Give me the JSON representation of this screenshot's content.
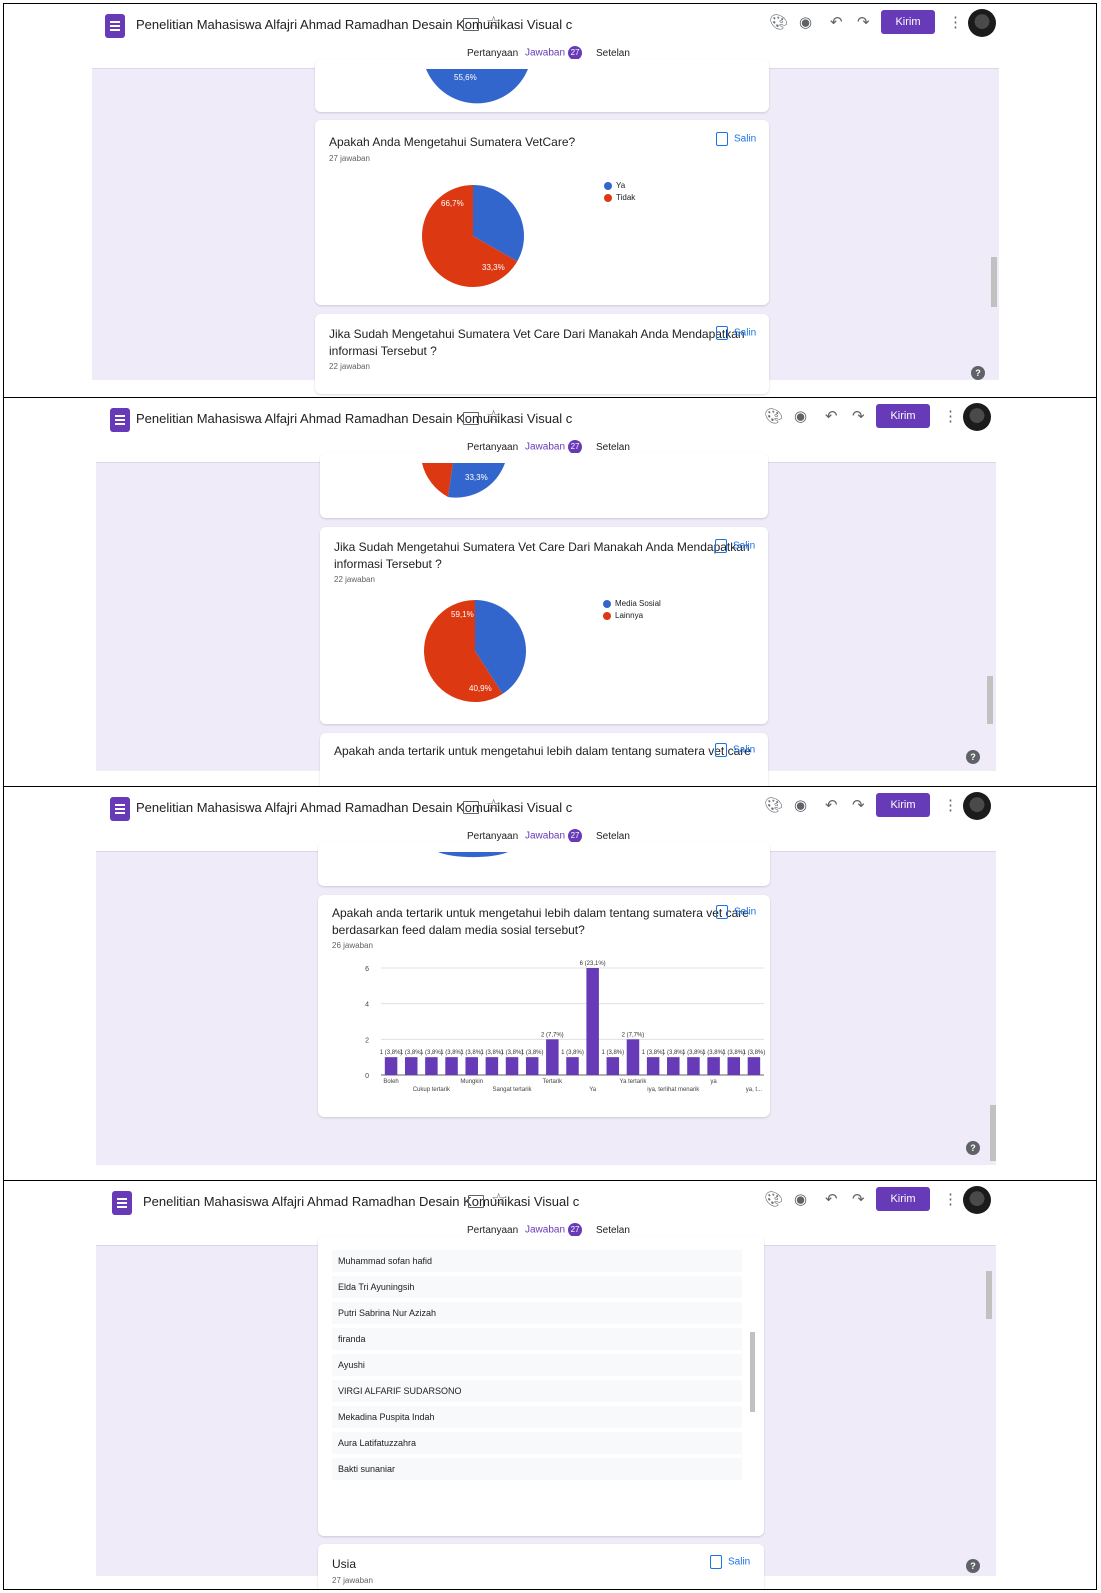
{
  "app": {
    "doc_title": "Penelitian Mahasiswa Alfajri Ahmad Ramadhan Desain Komunikasi Visual c",
    "send_label": "Kirim",
    "tabs": [
      "Pertanyaan",
      "Jawaban",
      "Setelan"
    ],
    "response_count": "27",
    "copy_label": "Salin",
    "help": "?"
  },
  "panels": [
    {
      "questions": [
        {
          "prev_label": "55,6%"
        },
        {
          "title": "Apakah Anda Mengetahui Sumatera VetCare?",
          "responses": "27 jawaban",
          "legend": [
            "Ya",
            "Tidak"
          ],
          "slice_labels": [
            "33,3%",
            "66,7%"
          ]
        },
        {
          "title_line1": "Jika Sudah Mengetahui Sumatera Vet Care Dari Manakah Anda Mendapatkan",
          "title_line2": "informasi Tersebut ?",
          "responses": "22 jawaban"
        }
      ]
    },
    {
      "questions": [
        {
          "prev_label": "33,3%"
        },
        {
          "title_line1": "Jika Sudah Mengetahui Sumatera Vet Care Dari Manakah Anda Mendapatkan",
          "title_line2": "informasi Tersebut ?",
          "responses": "22 jawaban",
          "legend": [
            "Media Sosial",
            "Lainnya"
          ],
          "slice_labels": [
            "40,9%",
            "59,1%"
          ]
        },
        {
          "title_line1": "Apakah anda tertarik untuk mengetahui lebih dalam tentang sumatera vet care"
        }
      ]
    },
    {
      "questions": [
        {
          "title_line1": "Apakah anda tertarik untuk mengetahui lebih dalam tentang sumatera vet care",
          "title_line2": "berdasarkan feed dalam media sosial tersebut?",
          "responses": "26 jawaban",
          "x_tick_labels": [
            "Boleh",
            "Cukup tertarik",
            "Mungkin",
            "Sangat tertarik",
            "Tertarik",
            "Ya",
            "Ya tertarik",
            "iya, terlihat menarik",
            "ya",
            "ya, t..."
          ]
        }
      ]
    },
    {
      "names": [
        "Muhammad sofan hafid",
        "Elda Tri Ayuningsih",
        "Putri Sabrina Nur Azizah",
        "firanda",
        "Ayushi",
        "VIRGI ALFARIF SUDARSONO",
        "Mekadina Puspita Indah",
        "Aura Latifatuzzahra",
        "Bakti sunaniar"
      ],
      "next_question": {
        "title": "Usia",
        "responses": "27 jawaban"
      }
    }
  ],
  "chart_data": [
    {
      "type": "pie",
      "title": "Apakah Anda Mengetahui Sumatera VetCare?",
      "labels": [
        "Ya",
        "Tidak"
      ],
      "values": [
        33.3,
        66.7
      ],
      "colors": [
        "#3366cc",
        "#dc3912"
      ]
    },
    {
      "type": "pie",
      "title": "Jika Sudah Mengetahui Sumatera Vet Care Dari Manakah Anda Mendapatkan informasi Tersebut ?",
      "labels": [
        "Media Sosial",
        "Lainnya"
      ],
      "values": [
        40.9,
        59.1
      ],
      "colors": [
        "#3366cc",
        "#dc3912"
      ]
    },
    {
      "type": "bar",
      "title": "Apakah anda tertarik untuk mengetahui lebih dalam tentang sumatera vet care berdasarkan feed dalam media sosial tersebut?",
      "values": [
        1,
        1,
        1,
        1,
        1,
        1,
        1,
        1,
        2,
        1,
        6,
        1,
        2,
        1,
        1,
        1,
        1,
        1,
        1
      ],
      "data_labels": [
        "1 (3,8%)",
        "1 (3,8%)",
        "1 (3,8%)",
        "1 (3,8%)",
        "1 (3,8%)",
        "1 (3,8%)",
        "1 (3,8%)",
        "1 (3,8%)",
        "2 (7,7%)",
        "1 (3,8%)",
        "6 (23,1%)",
        "1 (3,8%)",
        "2 (7,7%)",
        "1 (3,8%)",
        "1 (3,8%)",
        "1 (3,8%)",
        "1 (3,8%)",
        "1 (3,8%)",
        "1 (3,8%)"
      ],
      "y_ticks": [
        0,
        2,
        4,
        6
      ],
      "ylim": [
        0,
        6
      ],
      "color": "#673ab7"
    }
  ]
}
